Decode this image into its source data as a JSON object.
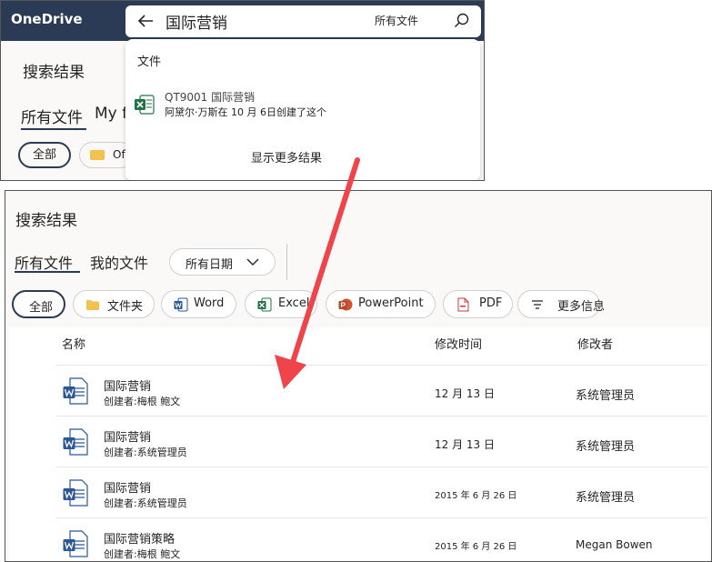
{
  "top": {
    "brand": "OneDrive",
    "search_query": "国际营销",
    "search_scope": "所有文件",
    "under_title": "搜索结果",
    "under_tab_all": "所有文件",
    "under_tab_mine_partial": "My f",
    "under_filter_all": "全部",
    "under_filter_folder_partial": "Of",
    "dropdown": {
      "header": "文件",
      "result_name": "QT9001 国际营销",
      "result_sub": "阿黛尔·万斯在 10 月 6日创建了这个",
      "more_results": "显示更多结果"
    }
  },
  "main": {
    "title": "搜索结果",
    "tabs": {
      "all": "所有文件",
      "mine": "我的文件"
    },
    "date_filter": "所有日期",
    "filters": {
      "all": "全部",
      "folder": "文件夹",
      "word": "Word",
      "excel": "Excel",
      "powerpoint": "PowerPoint",
      "pdf": "PDF",
      "more": "更多信息"
    },
    "columns": {
      "name": "名称",
      "modified": "修改时间",
      "modified_by": "修改者"
    },
    "rows": [
      {
        "name": "国际营销",
        "sub": "创建者:梅根 鲍文",
        "date": "12 月 13 日",
        "by": "系统管理员"
      },
      {
        "name": "国际营销",
        "sub": "创建者:系统管理员",
        "date": "12 月 13 日",
        "by": "系统管理员"
      },
      {
        "name": "国际营销",
        "sub": "创建者:系统管理员",
        "date": "2015 年 6 月 26 日",
        "by": "系统管理员"
      },
      {
        "name": "国际营销策略",
        "sub": "创建者:梅根 鲍文",
        "date": "2015 年 6 月 26 日",
        "by": "Megan Bowen"
      }
    ]
  },
  "colors": {
    "brand_bar": "#2b3b55",
    "arrow": "#f0444b",
    "word_blue": "#2b579a",
    "excel_green": "#217346"
  }
}
